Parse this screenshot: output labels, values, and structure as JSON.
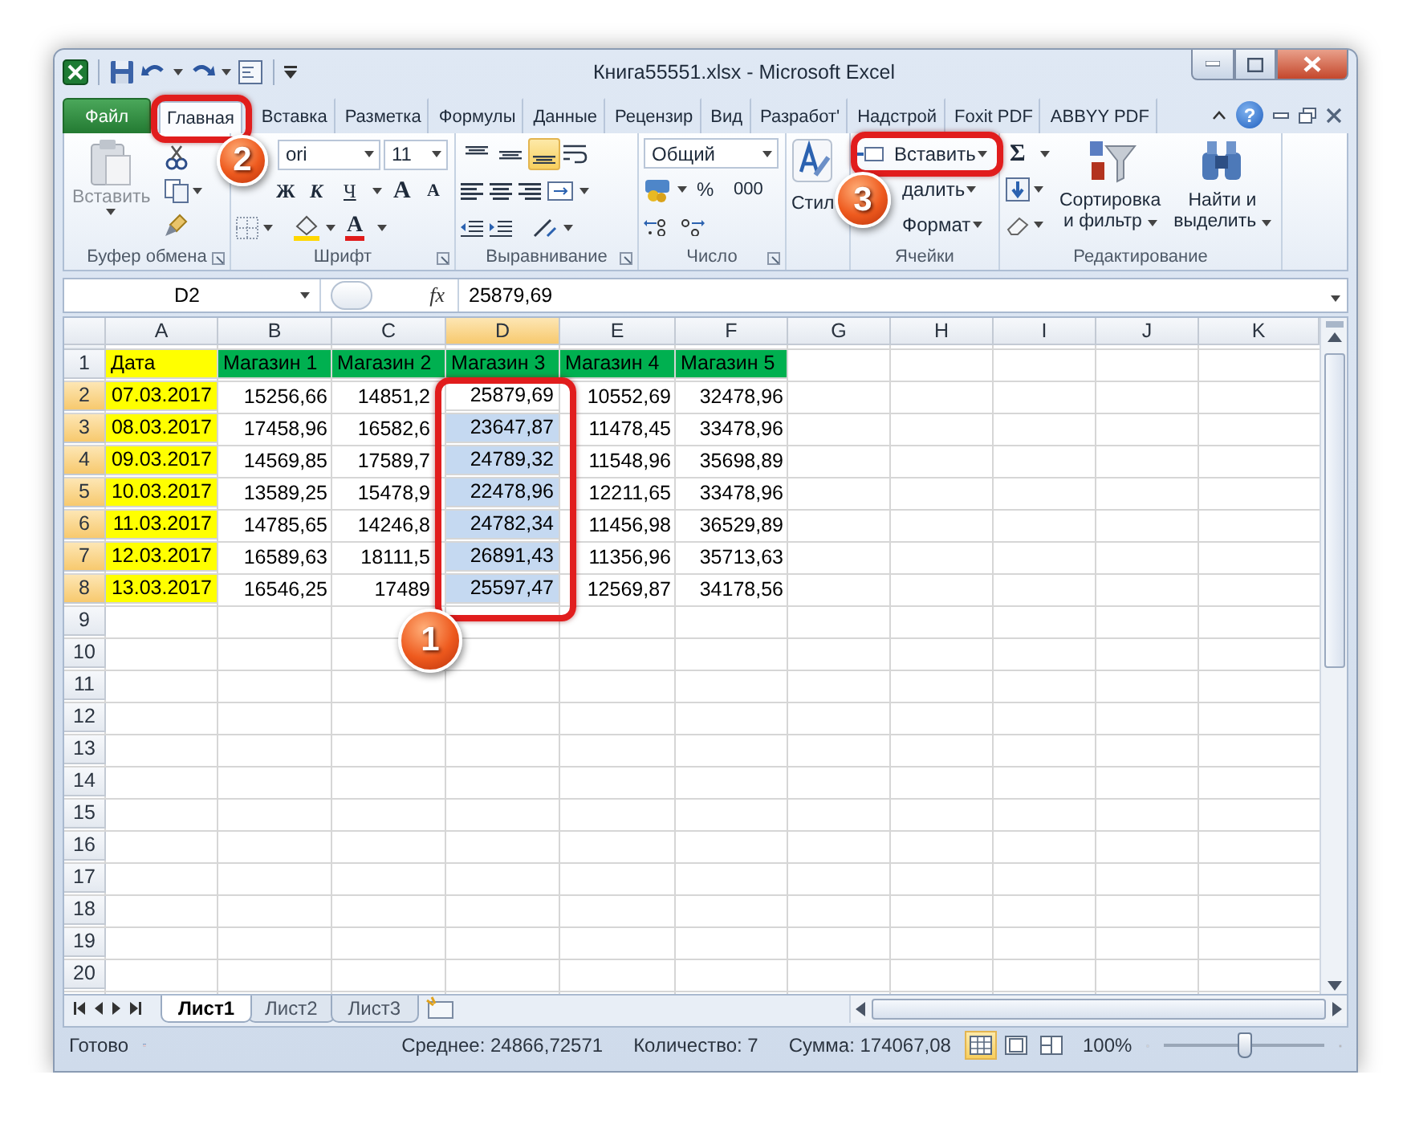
{
  "window": {
    "title": "Книга55551.xlsx - Microsoft Excel"
  },
  "ribbon_tabs": [
    {
      "label": "Файл",
      "kind": "file",
      "selected": false
    },
    {
      "label": "Главная",
      "kind": "tab",
      "selected": true
    },
    {
      "label": "Вставка",
      "kind": "tab",
      "selected": false
    },
    {
      "label": "Разметка",
      "kind": "tab",
      "selected": false
    },
    {
      "label": "Формулы",
      "kind": "tab",
      "selected": false
    },
    {
      "label": "Данные",
      "kind": "tab",
      "selected": false
    },
    {
      "label": "Рецензир",
      "kind": "tab",
      "selected": false
    },
    {
      "label": "Вид",
      "kind": "tab",
      "selected": false
    },
    {
      "label": "Разработ'",
      "kind": "tab",
      "selected": false
    },
    {
      "label": "Надстрой",
      "kind": "tab",
      "selected": false
    },
    {
      "label": "Foxit PDF",
      "kind": "tab",
      "selected": false
    },
    {
      "label": "ABBYY PDF",
      "kind": "tab",
      "selected": false
    }
  ],
  "help": "?",
  "ribbon": {
    "clipboard": {
      "paste": "Вставить",
      "label": "Буфер обмена"
    },
    "font": {
      "font_name": "ori",
      "font_size": "11",
      "styles": [
        "Ж",
        "К",
        "Ч"
      ],
      "size_buttons": [
        "A",
        "A"
      ],
      "font_color": "A",
      "label": "Шрифт"
    },
    "alignment": {
      "vertical": [
        {
          "selected": false
        },
        {
          "selected": false
        },
        {
          "selected": true
        }
      ],
      "label": "Выравнивание"
    },
    "number": {
      "format": "Общий",
      "percent": "%",
      "thousands": "000",
      "label": "Число"
    },
    "styles": {
      "label": "Стил"
    },
    "cells": {
      "items": [
        "Вставить",
        "далить",
        "Формат"
      ],
      "label": "Ячейки"
    },
    "editing": {
      "sum": "Σ",
      "sort": [
        "Сортировка",
        "и фильтр"
      ],
      "find": [
        "Найти и",
        "выделить"
      ],
      "label": "Редактирование"
    }
  },
  "formula_bar": {
    "name_box": "D2",
    "function_label": "fx",
    "value": "25879,69"
  },
  "sheet": {
    "columns": [
      {
        "label": "A",
        "selected": false,
        "color": "#ffff00"
      },
      {
        "label": "B",
        "selected": false
      },
      {
        "label": "C",
        "selected": false
      },
      {
        "label": "D",
        "selected": true
      },
      {
        "label": "E",
        "selected": false
      },
      {
        "label": "F",
        "selected": false
      },
      {
        "label": "G",
        "selected": false
      },
      {
        "label": "H",
        "selected": false
      },
      {
        "label": "I",
        "selected": false
      },
      {
        "label": "J",
        "selected": false
      },
      {
        "label": "K",
        "selected": false
      }
    ],
    "header_row": {
      "number": "1",
      "cells": [
        {
          "text": "Дата",
          "color": "#ffff00"
        },
        {
          "text": "Магазин 1",
          "color": "#00b050"
        },
        {
          "text": "Магазин 2",
          "color": "#00b050"
        },
        {
          "text": "Магазин 3",
          "color": "#00b050"
        },
        {
          "text": "Магазин 4",
          "color": "#00b050"
        },
        {
          "text": "Магазин 5",
          "color": "#00b050"
        }
      ]
    },
    "rows": [
      {
        "number": "2",
        "selected": true,
        "cells": [
          "07.03.2017",
          "15256,66",
          "14851,2",
          "25879,69",
          "10552,69",
          "32478,96"
        ]
      },
      {
        "number": "3",
        "selected": true,
        "cells": [
          "08.03.2017",
          "17458,96",
          "16582,6",
          "23647,87",
          "11478,45",
          "33478,96"
        ]
      },
      {
        "number": "4",
        "selected": true,
        "cells": [
          "09.03.2017",
          "14569,85",
          "17589,7",
          "24789,32",
          "11548,96",
          "35698,89"
        ]
      },
      {
        "number": "5",
        "selected": true,
        "cells": [
          "10.03.2017",
          "13589,25",
          "15478,9",
          "22478,96",
          "12211,65",
          "33478,96"
        ]
      },
      {
        "number": "6",
        "selected": true,
        "cells": [
          "11.03.2017",
          "14785,65",
          "14246,8",
          "24782,34",
          "11456,98",
          "36529,89"
        ]
      },
      {
        "number": "7",
        "selected": true,
        "cells": [
          "12.03.2017",
          "16589,63",
          "18111,5",
          "26891,43",
          "11356,96",
          "35713,63"
        ]
      },
      {
        "number": "8",
        "selected": true,
        "cells": [
          "13.03.2017",
          "16546,25",
          "17489",
          "25597,47",
          "12569,87",
          "34178,56"
        ]
      }
    ],
    "empty_rows": [
      "9",
      "10",
      "11",
      "12",
      "13",
      "14",
      "15",
      "16",
      "17",
      "18",
      "19",
      "20"
    ]
  },
  "sheet_tabs": [
    {
      "label": "Лист1",
      "selected": true
    },
    {
      "label": "Лист2",
      "selected": false
    },
    {
      "label": "Лист3",
      "selected": false
    }
  ],
  "status_bar": {
    "ready": "Готово",
    "average": "Среднее: 24866,72571",
    "count": "Количество: 7",
    "sum": "Сумма: 174067,08",
    "views": [
      {
        "selected": true
      },
      {
        "selected": false
      },
      {
        "selected": false
      }
    ],
    "zoom": "100%",
    "zoom_slider": {
      "level": 0.5
    }
  },
  "callouts": [
    {
      "label": "1"
    },
    {
      "label": "2"
    },
    {
      "label": "3"
    }
  ]
}
